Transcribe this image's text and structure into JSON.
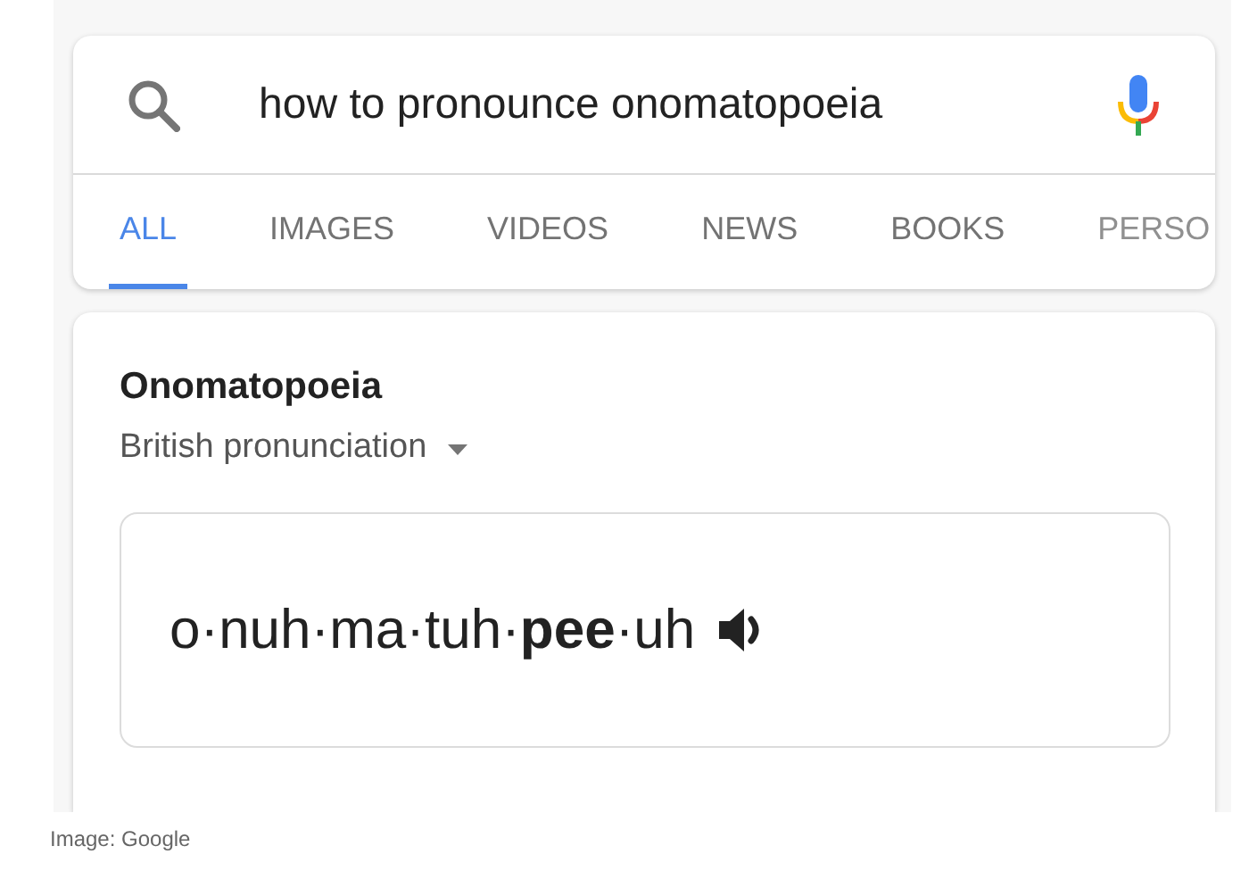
{
  "search": {
    "value": "how to pronounce onomatopoeia"
  },
  "tabs": [
    {
      "label": "ALL",
      "selected": true
    },
    {
      "label": "IMAGES",
      "selected": false
    },
    {
      "label": "VIDEOS",
      "selected": false
    },
    {
      "label": "NEWS",
      "selected": false
    },
    {
      "label": "BOOKS",
      "selected": false
    },
    {
      "label": "PERSO",
      "selected": false
    }
  ],
  "result": {
    "title": "Onomatopoeia",
    "dialect": "British pronunciation",
    "phonetic": "o·nuh·ma·tuh·**pee**·uh"
  },
  "caption": "Image: Google"
}
